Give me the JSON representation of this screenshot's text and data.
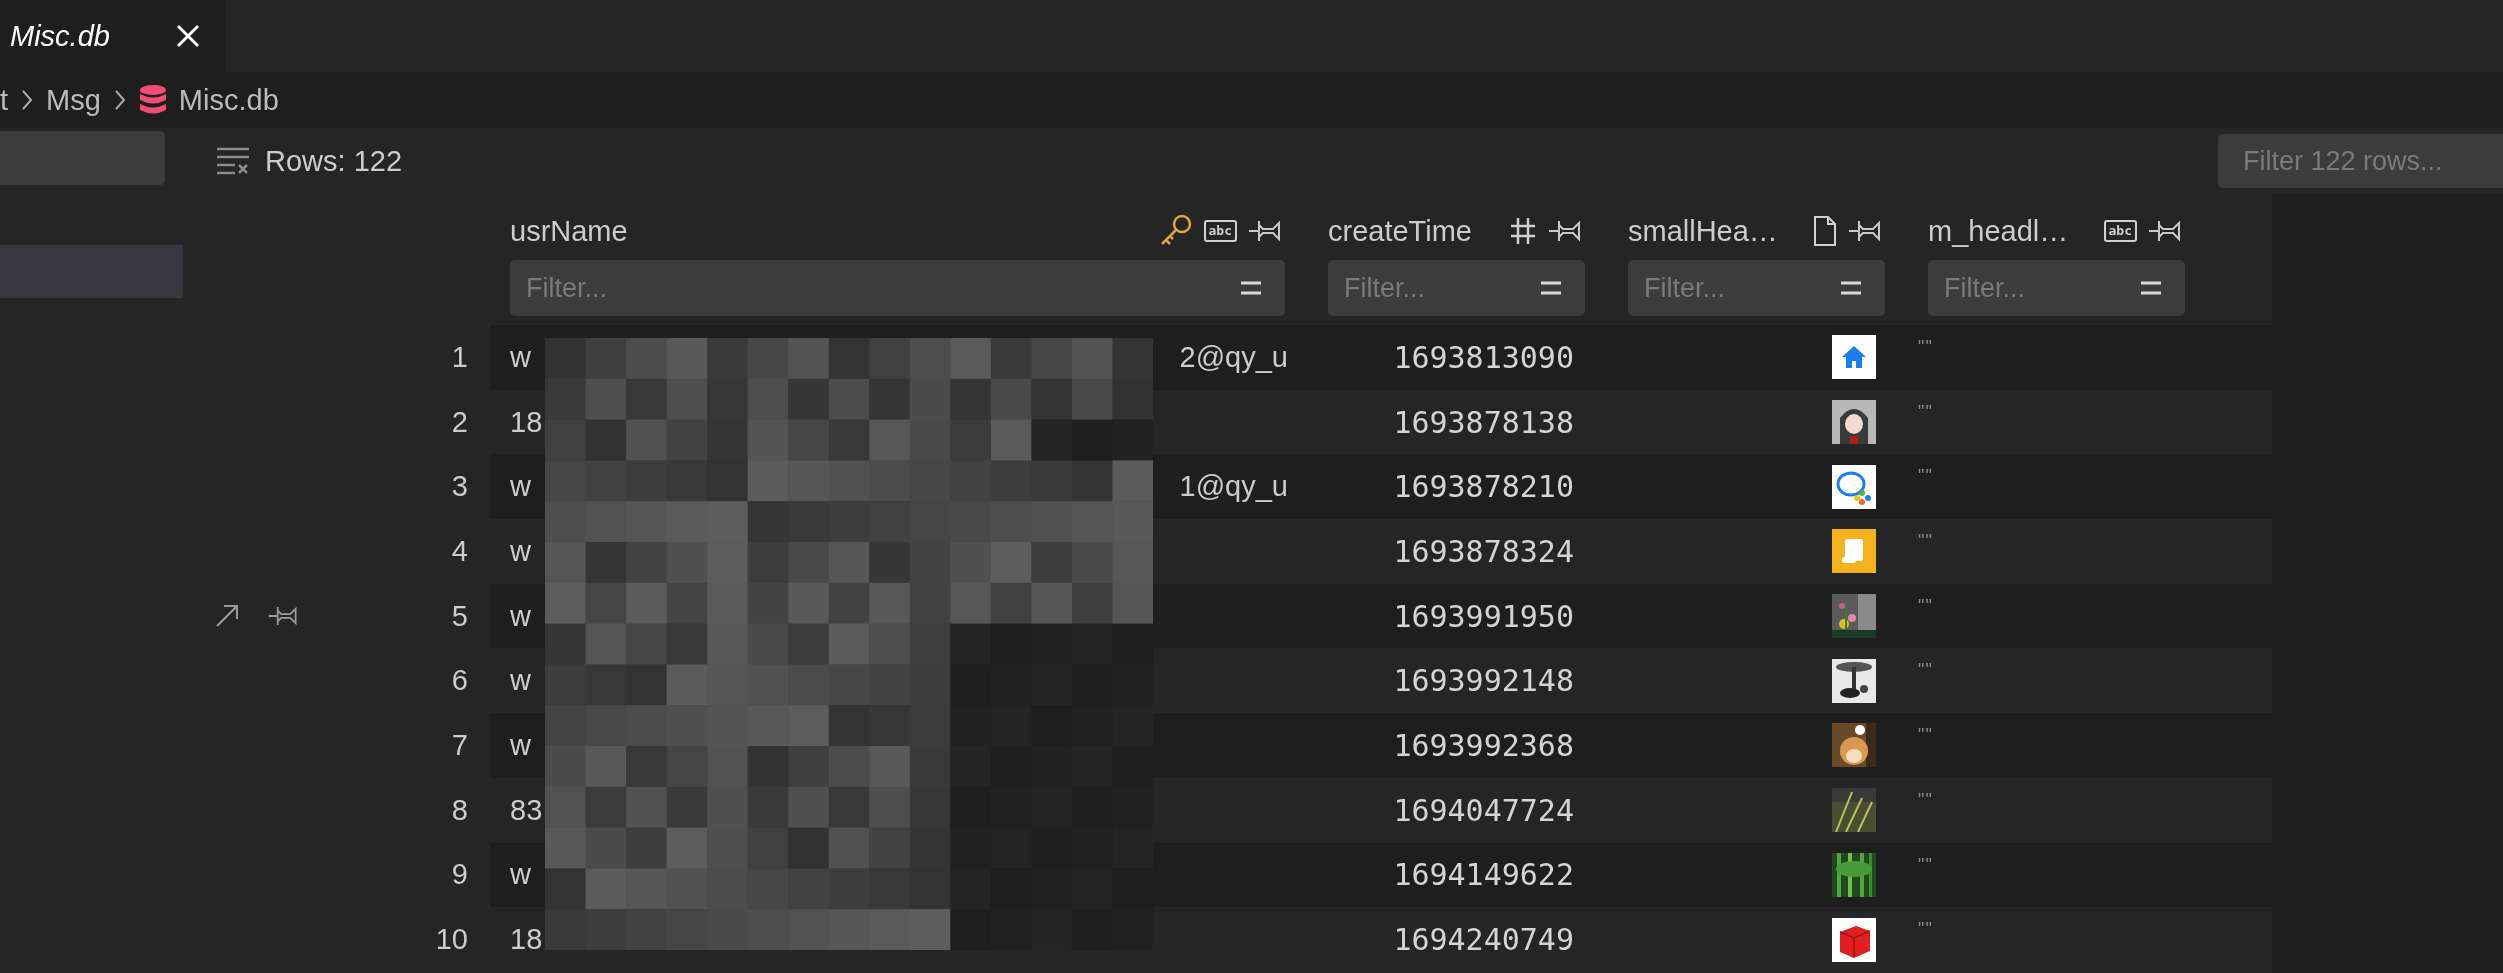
{
  "tab": {
    "title": "Misc.db",
    "preview": true
  },
  "breadcrumb": [
    {
      "label": "t",
      "kind": "folder"
    },
    {
      "label": "Msg",
      "kind": "folder"
    },
    {
      "label": "Misc.db",
      "kind": "database"
    }
  ],
  "sidebar": {
    "items": [
      {
        "selected": true
      }
    ]
  },
  "toolbar": {
    "rows_label": "Rows: 122",
    "filter_placeholder": "Filter 122 rows..."
  },
  "table": {
    "columns": [
      {
        "name": "usrName",
        "filter_placeholder": "Filter...",
        "icons": [
          {
            "kind": "key"
          },
          {
            "kind": "badge",
            "label": "abc"
          }
        ]
      },
      {
        "name": "createTime",
        "filter_placeholder": "Filter...",
        "icons": [
          {
            "kind": "hash"
          }
        ]
      },
      {
        "name": "smallHea…",
        "filter_placeholder": "Filter...",
        "icons": [
          {
            "kind": "file"
          }
        ]
      },
      {
        "name": "m_headl…",
        "filter_placeholder": "Filter...",
        "icons": [
          {
            "kind": "badge",
            "label": "abc"
          }
        ]
      }
    ],
    "rows": [
      {
        "num": "1",
        "hovered": false,
        "usrName": {
          "start": "w",
          "end": "2@qy_u"
        },
        "createTime": "1693813090",
        "m_headl": "\"\""
      },
      {
        "num": "2",
        "hovered": false,
        "usrName": {
          "start": "18"
        },
        "createTime": "1693878138",
        "m_headl": "\"\""
      },
      {
        "num": "3",
        "hovered": false,
        "usrName": {
          "start": "w",
          "end": "1@qy_u"
        },
        "createTime": "1693878210",
        "m_headl": "\"\""
      },
      {
        "num": "4",
        "hovered": false,
        "usrName": {
          "start": "w"
        },
        "createTime": "1693878324",
        "m_headl": "\"\""
      },
      {
        "num": "5",
        "hovered": true,
        "usrName": {
          "start": "w"
        },
        "createTime": "1693991950",
        "m_headl": "\"\""
      },
      {
        "num": "6",
        "hovered": false,
        "usrName": {
          "start": "w"
        },
        "createTime": "1693992148",
        "m_headl": "\"\""
      },
      {
        "num": "7",
        "hovered": false,
        "usrName": {
          "start": "w"
        },
        "createTime": "1693992368",
        "m_headl": "\"\""
      },
      {
        "num": "8",
        "hovered": false,
        "usrName": {
          "start": "83"
        },
        "createTime": "1694047724",
        "m_headl": "\"\""
      },
      {
        "num": "9",
        "hovered": false,
        "usrName": {
          "start": "w"
        },
        "createTime": "1694149622",
        "m_headl": "\"\""
      },
      {
        "num": "10",
        "hovered": false,
        "usrName": {
          "start": "18"
        },
        "createTime": "1694240749",
        "m_headl": "\"\""
      }
    ]
  }
}
